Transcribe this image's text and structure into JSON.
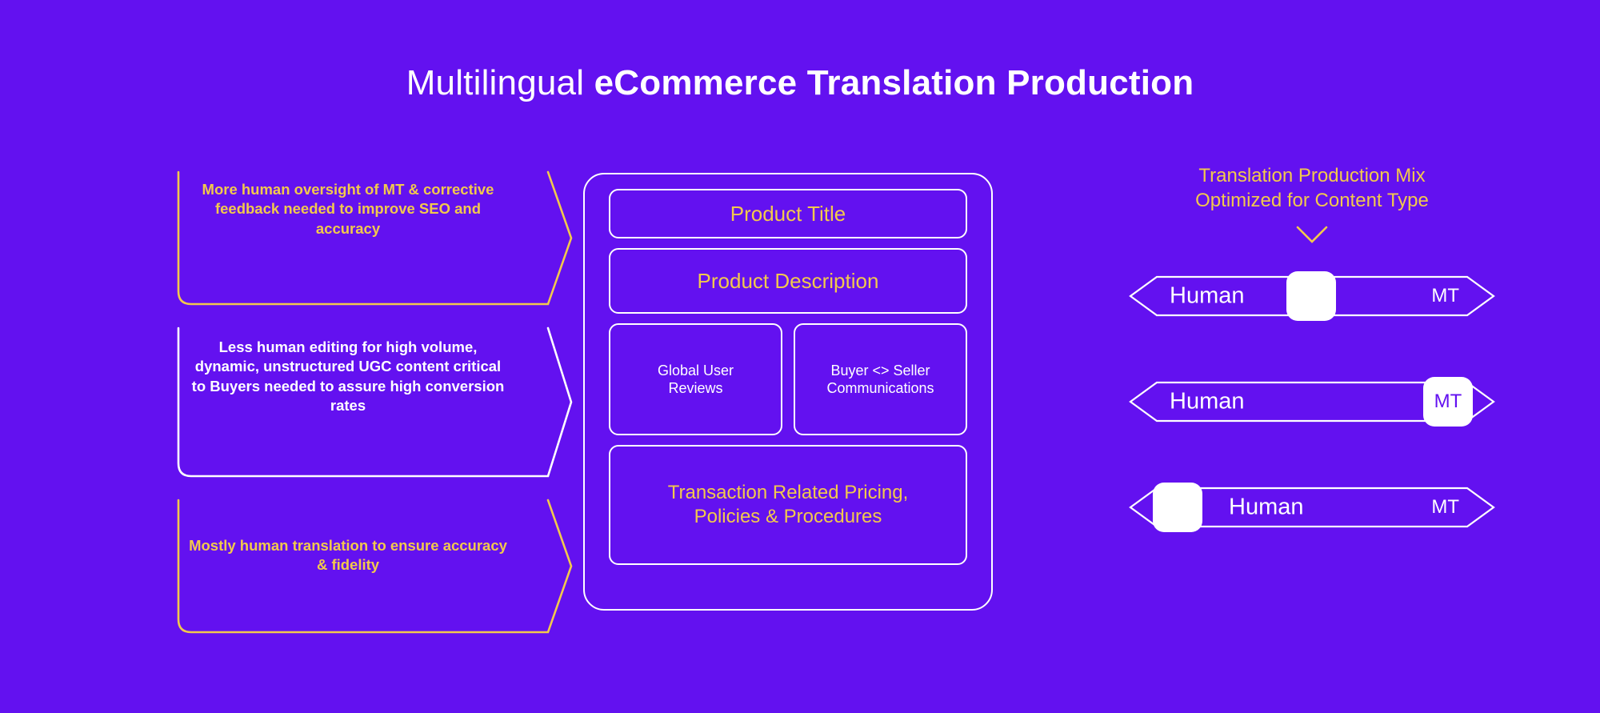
{
  "colors": {
    "background": "#6311F0",
    "gold": "#F2C94C",
    "white": "#FFFFFF"
  },
  "header": {
    "title_light": "Multilingual ",
    "title_bold": "eCommerce Translation Production"
  },
  "callouts": [
    {
      "id": "callout-seo",
      "text": "More human oversight of MT & corrective feedback needed to improve SEO and accuracy",
      "color": "gold"
    },
    {
      "id": "callout-ugc",
      "text": "Less human editing for high volume, dynamic, unstructured UGC content critical to Buyers needed to assure high conversion rates",
      "color": "white"
    },
    {
      "id": "callout-human-translation",
      "text": "Mostly human translation to ensure accuracy & fidelity",
      "color": "gold"
    }
  ],
  "content_panel": {
    "product_title": "Product Title",
    "product_description": "Product Description",
    "global_user_reviews": "Global User\nReviews",
    "buyer_seller_communications": "Buyer <> Seller\nCommunications",
    "transaction_related": "Transaction Related Pricing,\nPolicies & Procedures"
  },
  "sliders_section": {
    "heading": "Translation Production Mix\nOptimized for Content Type",
    "chevron_icon": "chevron-down-icon",
    "sliders": [
      {
        "id": "slider-product-content",
        "left_label": "Human",
        "right_label": "MT",
        "handle_position": "center",
        "handle_label": "",
        "handle_percent": 50
      },
      {
        "id": "slider-ugc-content",
        "left_label": "Human",
        "right_label": "MT",
        "handle_position": "right",
        "handle_label": "MT",
        "handle_percent": 92
      },
      {
        "id": "slider-transaction-content",
        "left_label": "Human",
        "right_label": "MT",
        "handle_position": "left",
        "handle_label": "",
        "handle_percent": 8
      }
    ]
  }
}
